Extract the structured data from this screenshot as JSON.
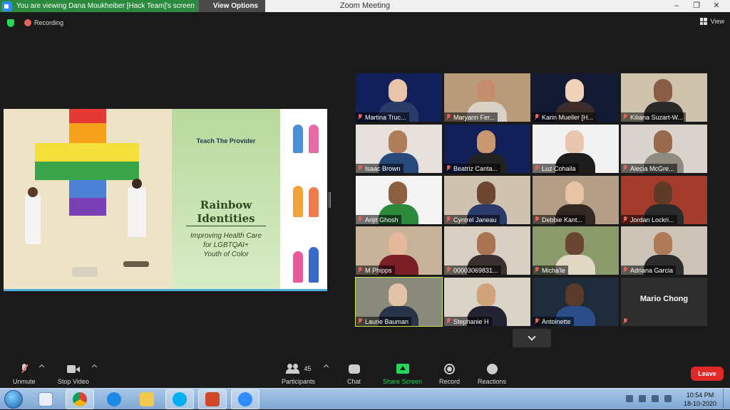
{
  "window": {
    "title": "Zoom Meeting",
    "viewing_banner": "You are viewing Dana Moukheiber [Hack Team]'s screen",
    "view_options": "View Options",
    "controls": [
      "–",
      "❐",
      "✕"
    ]
  },
  "top_bar": {
    "recording_label": "Recording",
    "view_label": "View"
  },
  "shared_slide": {
    "kicker": "Teach The Provider",
    "title_line1": "Rainbow",
    "title_line2": "Identities",
    "subtitle_line1": "Improving Health Care",
    "subtitle_line2": "for LGBTQAI+",
    "subtitle_line3": "Youth of Color"
  },
  "participants": [
    {
      "name": "Martina Truc...",
      "bg": "#12205a",
      "skin": "#e9c4a8",
      "shirt": "#2a3b6a"
    },
    {
      "name": "Maryann Fer...",
      "bg": "#b99b7b",
      "skin": "#c48d6b",
      "shirt": "#d9d0c6"
    },
    {
      "name": "Karin Mueller [H...",
      "bg": "#131a33",
      "skin": "#f0d2ba",
      "shirt": "#3b2d2a"
    },
    {
      "name": "Kiliana Suzart-W...",
      "bg": "#cfc3ad",
      "skin": "#8a5c44",
      "shirt": "#2a2a2a"
    },
    {
      "name": "Isaac Brown",
      "bg": "#e6e1dd",
      "skin": "#b07d5b",
      "shirt": "#274a7a"
    },
    {
      "name": "Beatriz Canta...",
      "bg": "#12205a",
      "skin": "#c89670",
      "shirt": "#222"
    },
    {
      "name": "Luz Cohaila",
      "bg": "#f2f2f2",
      "skin": "#e7c6ad",
      "shirt": "#1d1d1d"
    },
    {
      "name": "Alecia McGre...",
      "bg": "#d9d5ce",
      "skin": "#9a6a4e",
      "shirt": "#8e8b80"
    },
    {
      "name": "Arijit Ghosh",
      "bg": "#f4f4f4",
      "skin": "#8a6040",
      "shirt": "#2a8a3a"
    },
    {
      "name": "Cyntrel Janeau",
      "bg": "#d0c2b0",
      "skin": "#6e4631",
      "shirt": "#2a3a6a"
    },
    {
      "name": "Debbie Kant...",
      "bg": "#b49f86",
      "skin": "#e8c3a6",
      "shirt": "#332822"
    },
    {
      "name": "Jordan Lockri...",
      "bg": "#a33a2a",
      "skin": "#5e3b28",
      "shirt": "#2a2a2a"
    },
    {
      "name": "M Phipps",
      "bg": "#c7b29a",
      "skin": "#e5b89b",
      "shirt": "#7a1f28"
    },
    {
      "name": "00003069831...",
      "bg": "#d7cfc1",
      "skin": "#a87452",
      "shirt": "#3a3030"
    },
    {
      "name": "Micha'le",
      "bg": "#8a9a6a",
      "skin": "#6a4532",
      "shirt": "#e0d7c4"
    },
    {
      "name": "Adriana Garcia",
      "bg": "#ccc4b6",
      "skin": "#b07a58",
      "shirt": "#2c2c2c"
    },
    {
      "name": "Laurie Bauman",
      "bg": "#8a8a7a",
      "skin": "#e4c2a8",
      "shirt": "#283248"
    },
    {
      "name": "Stephanie H",
      "bg": "#dad3c8",
      "skin": "#d1a37d",
      "shirt": "#223"
    },
    {
      "name": "Antoinette",
      "bg": "#1f2a3a",
      "skin": "#5a3a28",
      "shirt": "#2a4d8a"
    },
    {
      "name": "Mario Chong",
      "bg": "#2e2e2e",
      "skin": "",
      "shirt": ""
    }
  ],
  "toolbar": {
    "unmute": "Unmute",
    "stop_video": "Stop Video",
    "participants": "Participants",
    "participants_count": "45",
    "chat": "Chat",
    "share_screen": "Share Screen",
    "record": "Record",
    "reactions": "Reactions",
    "leave": "Leave"
  },
  "taskbar": {
    "time": "10:54 PM",
    "date": "18-10-2020"
  },
  "colors": {
    "accent_green": "#23d959",
    "leave_red": "#e02828",
    "muted_red": "#e8615a",
    "active_speaker": "#c9e04a"
  }
}
